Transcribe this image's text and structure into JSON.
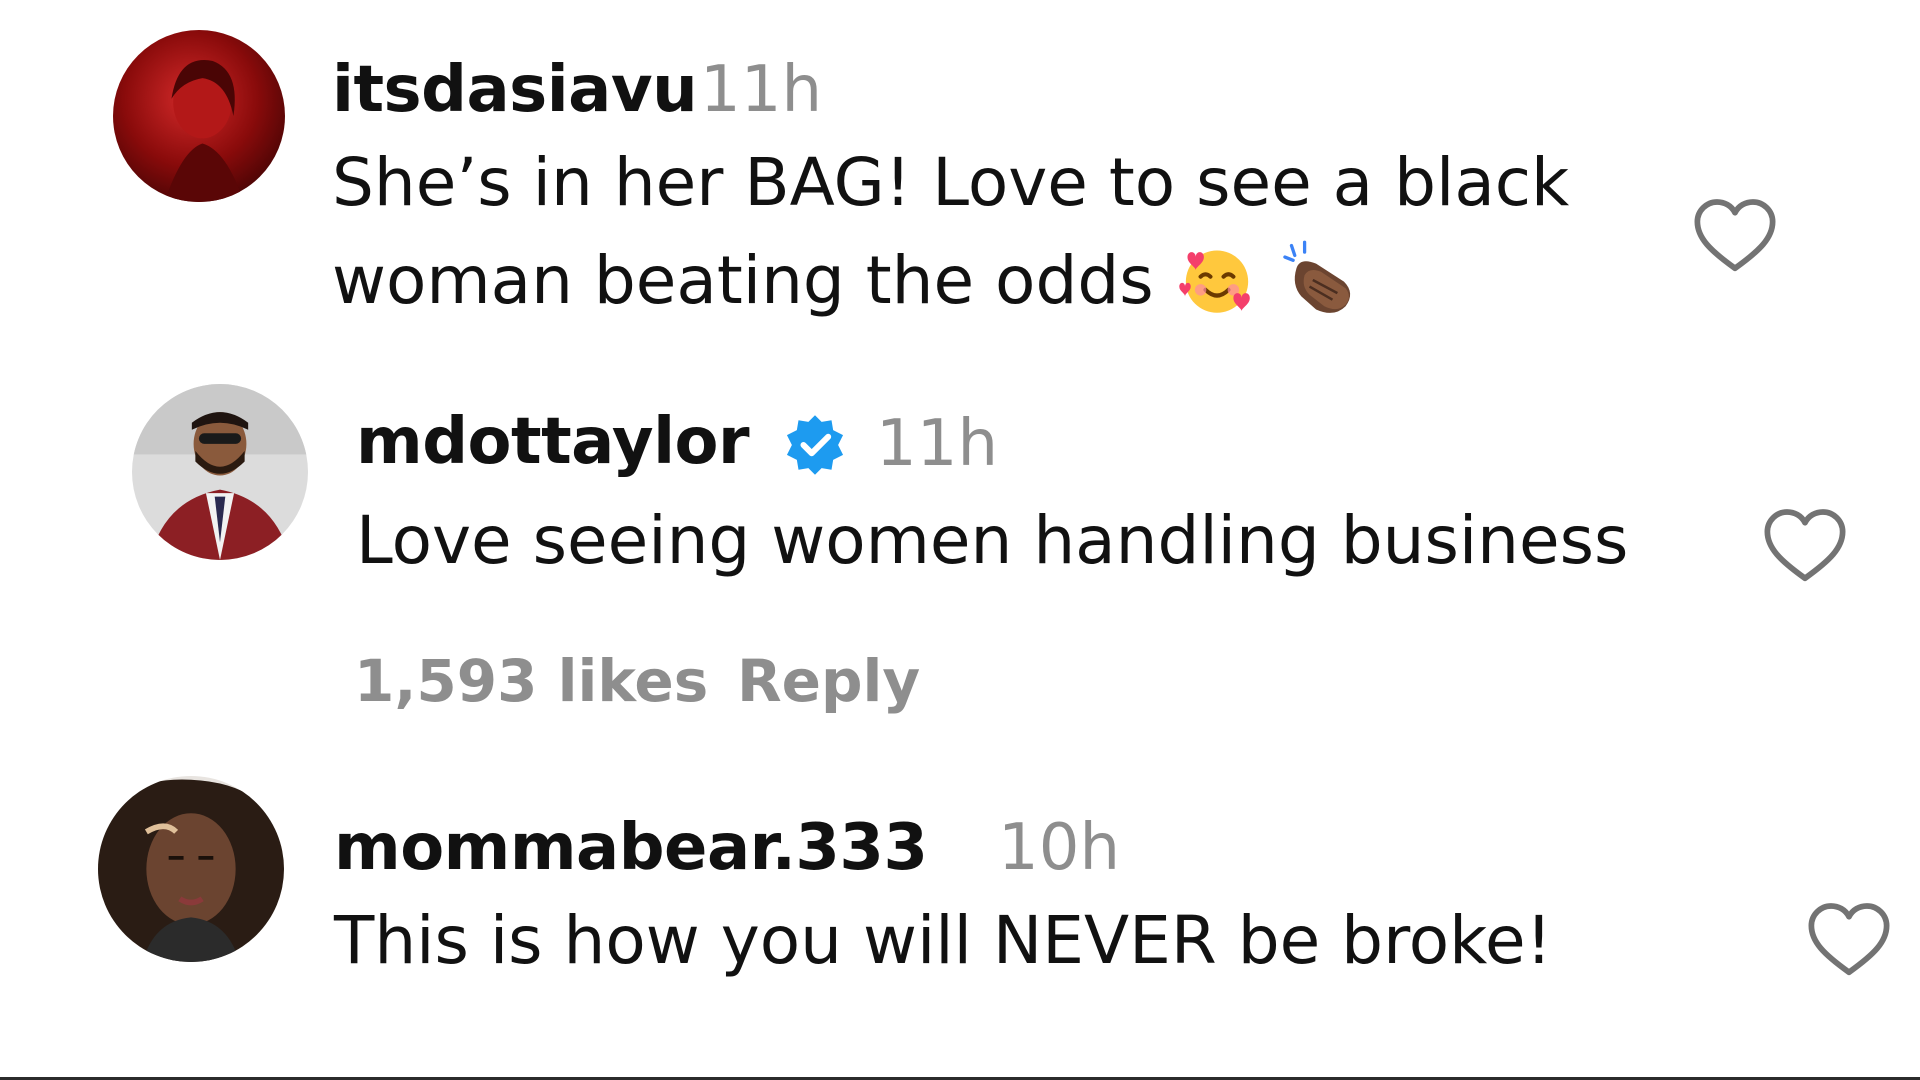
{
  "colors": {
    "text": "#111111",
    "muted": "#8e8e8e",
    "verified": "#1d9bf0",
    "heart_outline": "#737373"
  },
  "comments": [
    {
      "username": "itsdasiavu",
      "time": "11h",
      "text_line1": "She’s in her BAG! Love to see a black",
      "text_line2": "woman beating the odds",
      "emojis": [
        "smiling-face-with-hearts-emoji",
        "clapping-hands-emoji"
      ],
      "like_icon": "heart-outline-icon"
    },
    {
      "username": "mdottaylor",
      "verified": true,
      "time": "11h",
      "text": "Love seeing women handling business",
      "likes": "1,593 likes",
      "reply": "Reply",
      "like_icon": "heart-outline-icon"
    },
    {
      "username": "mommabear.333",
      "time": "10h",
      "text": "This is how you will NEVER be broke!",
      "like_icon": "heart-outline-icon"
    }
  ]
}
